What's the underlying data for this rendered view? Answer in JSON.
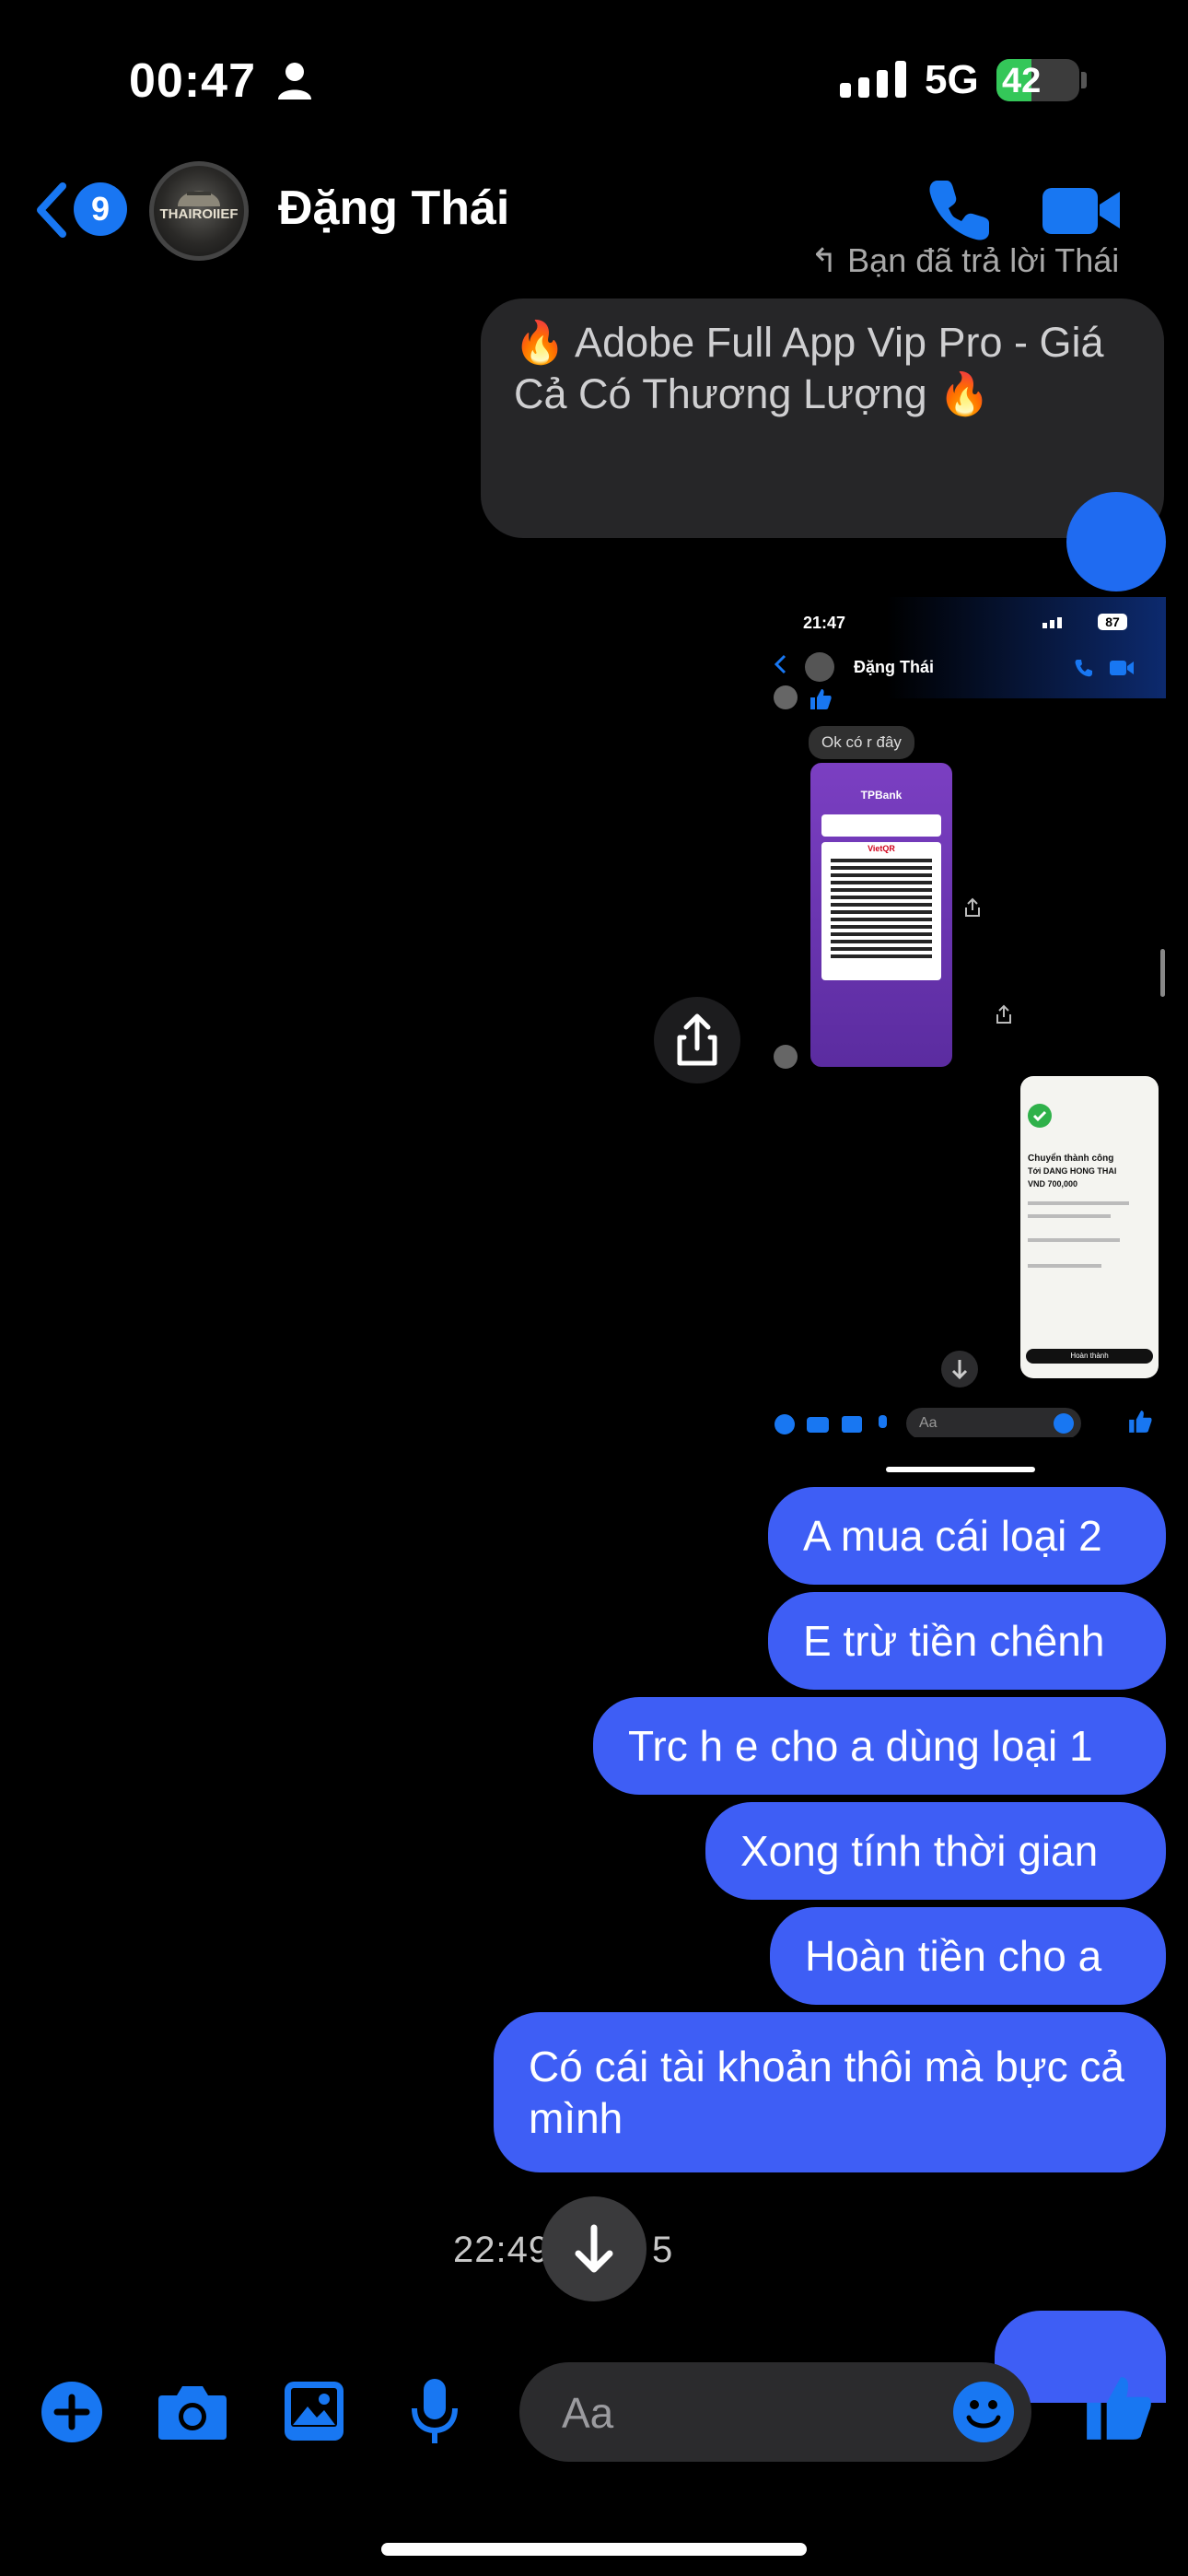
{
  "status_bar": {
    "time": "00:47",
    "network": "5G",
    "battery": "42",
    "battery_level_pct": 42
  },
  "header": {
    "back_badge": "9",
    "avatar_text": "THAIROIIEF",
    "contact_name": "Đặng Thái"
  },
  "reply_hint": "↰ Bạn đã trả lời Thái",
  "shared_card": {
    "text": "🔥 Adobe Full App Vip Pro - Giá Cả Có Thương Lượng 🔥"
  },
  "embedded_screenshot": {
    "time": "21:47",
    "battery": "87",
    "contact_name": "Đặng Thái",
    "bubble_text": "Ok có r đây",
    "bank_name": "TPBank",
    "vietqr": "VietQR",
    "receipt_title": "Chuyển thành công",
    "receipt_name": "Tới DANG HONG THAI",
    "receipt_amount": "VND 700,000",
    "receipt_button": "Hoàn thành",
    "composer_placeholder": "Aa"
  },
  "messages": [
    {
      "text": "A mua cái loại 2"
    },
    {
      "text": "E trừ tiền chênh"
    },
    {
      "text": "Trc h e cho a dùng loại 1"
    },
    {
      "text": "Xong tính thời gian"
    },
    {
      "text": "Hoàn tiền cho a"
    },
    {
      "text": "Có cái tài khoản thôi mà bực cả mình"
    }
  ],
  "timestamp": "22:49 THG 5",
  "composer": {
    "placeholder": "Aa"
  },
  "colors": {
    "accent": "#3e5ef5",
    "icon_blue": "#1877f2",
    "background": "#000000"
  }
}
